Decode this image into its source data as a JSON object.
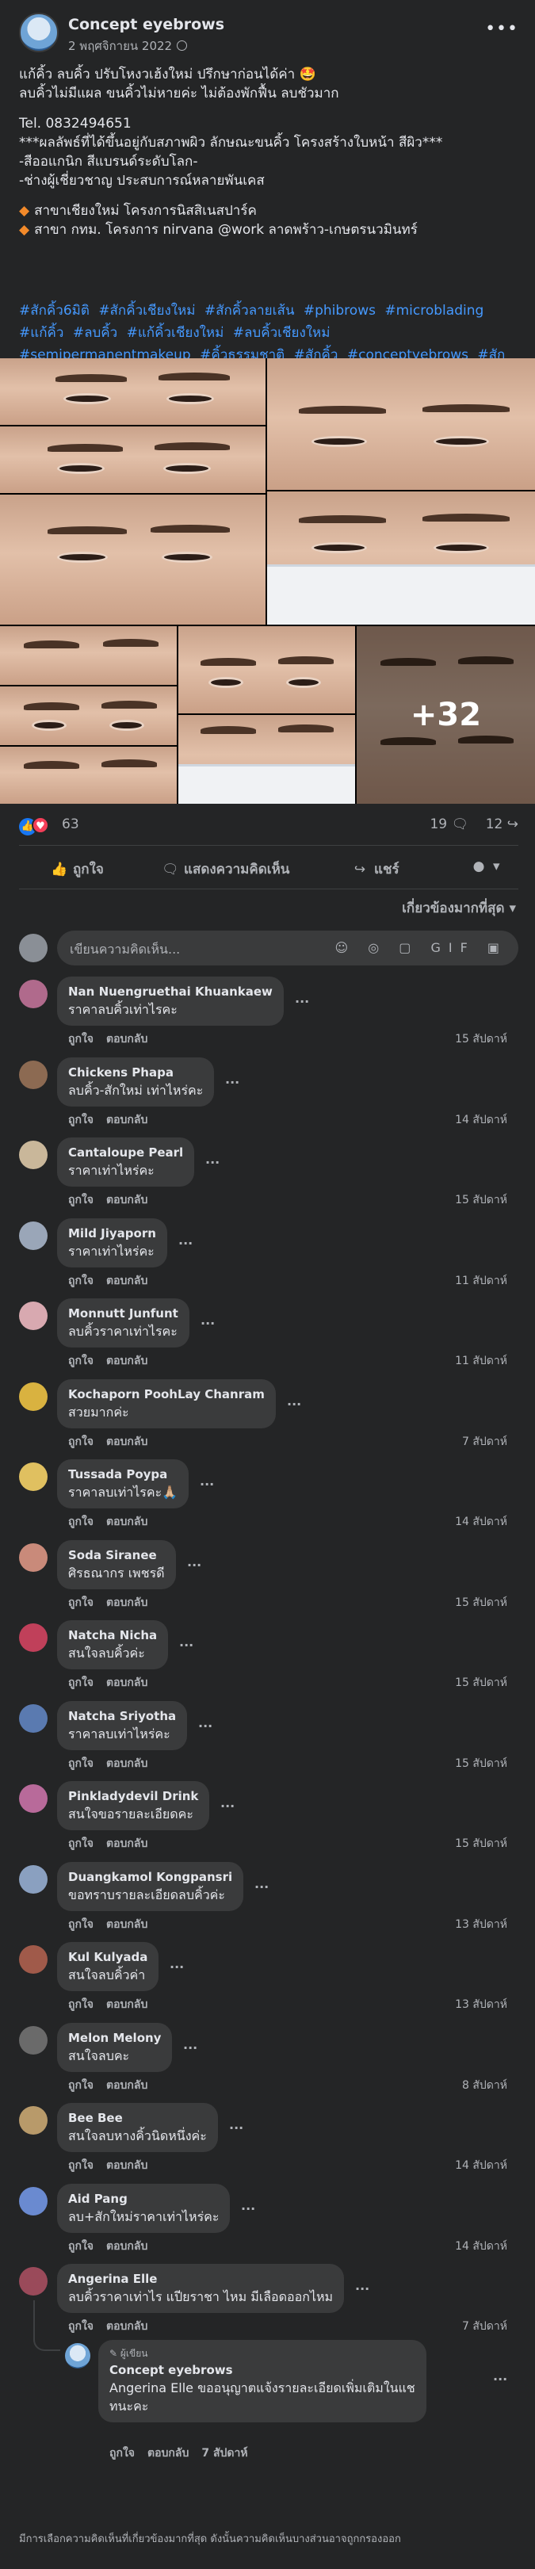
{
  "post": {
    "page_name": "Concept eyebrows",
    "date": "2 พฤศจิกายน 2022",
    "more_label": "•••",
    "lines": [
      "แก้คิ้ว ลบคิ้ว ปรับโหงวเฮ้งใหม่ ปรึกษาก่อนได้ค่า 🤩",
      "ลบคิ้วไม่มีแผล ขนคิ้วไม่หายค่ะ ไม่ต้องพักฟื้น ลบชัวมาก",
      "",
      "Tel. 0832494651",
      "***ผลลัพธ์ที่ได้ขึ้นอยู่กับสภาพผิว ลักษณะขนคิ้ว โครงสร้างใบหน้า สีผิว***",
      "-สีออแกนิก สีแบรนด์ระดับโลก-",
      "-ช่างผู้เชี่ยวชาญ ประสบการณ์หลายพันเคส",
      "",
      "สาขาเชียงใหม่  โครงการนิสสิเนสปาร์ค",
      "สาขา กทม.  โครงการ nirvana @work ลาดพร้าว-เกษตรนวมินทร์"
    ],
    "hashtags": [
      "#สักคิ้ว6มิติ",
      "#สักคิ้วเชียงใหม่",
      "#สักคิ้วลายเส้น",
      "#phibrows",
      "#microblading",
      "#แก้คิ้ว",
      "#ลบคิ้ว",
      "#แก้คิ้วเชียงใหม่",
      "#ลบคิ้วเชียงใหม่",
      "#semipermanentmakeup",
      "#คิ้วธรรมชาติ",
      "#สักคิ้ว",
      "#conceptyebrows",
      "#สักคิ้วกรุงเทพ"
    ],
    "more_photos": "+32",
    "reaction_count": "63",
    "comment_count": "19",
    "share_count": "12",
    "actions": {
      "like": "ถูกใจ",
      "comment": "แสดงความคิดเห็น",
      "share": "แชร์"
    },
    "sort_label": "เกี่ยวข้องมากที่สุด ▾",
    "composer_placeholder": "เขียนความคิดเห็น...",
    "composer_tools": "☺ ◎ ▢ GIF ▣"
  },
  "comment_actions": {
    "like": "ถูกใจ",
    "reply": "ตอบกลับ"
  },
  "comments": [
    {
      "name": "Nan Nuengruethai Khuankaew",
      "text": "ราคาลบคิ้วเท่าไรคะ",
      "time": "15 สัปดาห์",
      "avatar": "#b06a8c"
    },
    {
      "name": "Chickens Phapa",
      "text": "ลบคิ้ว-สักใหม่ เท่าไหร่คะ",
      "time": "14 สัปดาห์",
      "avatar": "#8c6a52"
    },
    {
      "name": "Cantaloupe Pearl",
      "text": "ราคาเท่าไหร่คะ",
      "time": "15 สัปดาห์",
      "avatar": "#c9b79a"
    },
    {
      "name": "Mild Jiyaporn",
      "text": "ราคาเท่าไหร่คะ",
      "time": "11 สัปดาห์",
      "avatar": "#9aa6b8"
    },
    {
      "name": "Monnutt Junfunt",
      "text": "ลบคิ้วราคาเท่าไรคะ",
      "time": "11 สัปดาห์",
      "avatar": "#d8a9b0"
    },
    {
      "name": "Kochaporn PoohLay Chanram",
      "text": "สวยมากค่ะ",
      "time": "7 สัปดาห์",
      "avatar": "#d9b240"
    },
    {
      "name": "Tussada Poypa",
      "text": "ราคาลบเท่าไรคะ🙏🏼",
      "time": "14 สัปดาห์",
      "avatar": "#e0c060"
    },
    {
      "name": "Soda Siranee",
      "text": "ศิรธณากร เพชรดี",
      "time": "15 สัปดาห์",
      "avatar": "#c98a7a"
    },
    {
      "name": "Natcha Nicha",
      "text": "สนใจลบคิ้วค่ะ",
      "time": "15 สัปดาห์",
      "avatar": "#c0405a"
    },
    {
      "name": "Natcha Sriyotha",
      "text": "ราคาลบเท่าไหร่คะ",
      "time": "15 สัปดาห์",
      "avatar": "#5a7ab0"
    },
    {
      "name": "Pinkladydevil Drink",
      "text": "สนใจขอรายละเอียดคะ",
      "time": "15 สัปดาห์",
      "avatar": "#b86a9a"
    },
    {
      "name": "Duangkamol Kongpansri",
      "text": "ขอทราบรายละเอียดลบคิ้วค่ะ",
      "time": "13 สัปดาห์",
      "avatar": "#8aa0c0"
    },
    {
      "name": "Kul Kulyada",
      "text": "สนใจลบคิ้วค่า",
      "time": "13 สัปดาห์",
      "avatar": "#a05a4a"
    },
    {
      "name": "Melon Melony",
      "text": "สนใจลบคะ",
      "time": "8 สัปดาห์",
      "avatar": "#6a6a6a"
    },
    {
      "name": "Bee Bee",
      "text": "สนใจลบหางคิ้วนิดหนึ่งค่ะ",
      "time": "14 สัปดาห์",
      "avatar": "#b89a6a"
    },
    {
      "name": "Aid Pang",
      "text": "ลบ+สักใหม่ราคาเท่าไหร่คะ",
      "time": "14 สัปดาห์",
      "avatar": "#6a8ad0"
    },
    {
      "name": "Angerina Elle",
      "text": "ลบคิ้วราคาเท่าไร แปียราชา ไหม มีเลือดออกไหม",
      "time": "7 สัปดาห์",
      "avatar": "#9a4a5a"
    }
  ],
  "reply": {
    "badge": "ผู้เขียน",
    "name": "Concept eyebrows",
    "text_line1": "Angerina Elle ขออนุญาตแจ้งรายละเอียดเพิ่มเติมในแช",
    "text_line2": "ทนะคะ",
    "time": "7 สัปดาห์"
  },
  "footer_note": "มีการเลือกความคิดเห็นที่เกี่ยวข้องมากที่สุด ดังนั้นความคิดเห็นบางส่วนอาจถูกกรองออก"
}
